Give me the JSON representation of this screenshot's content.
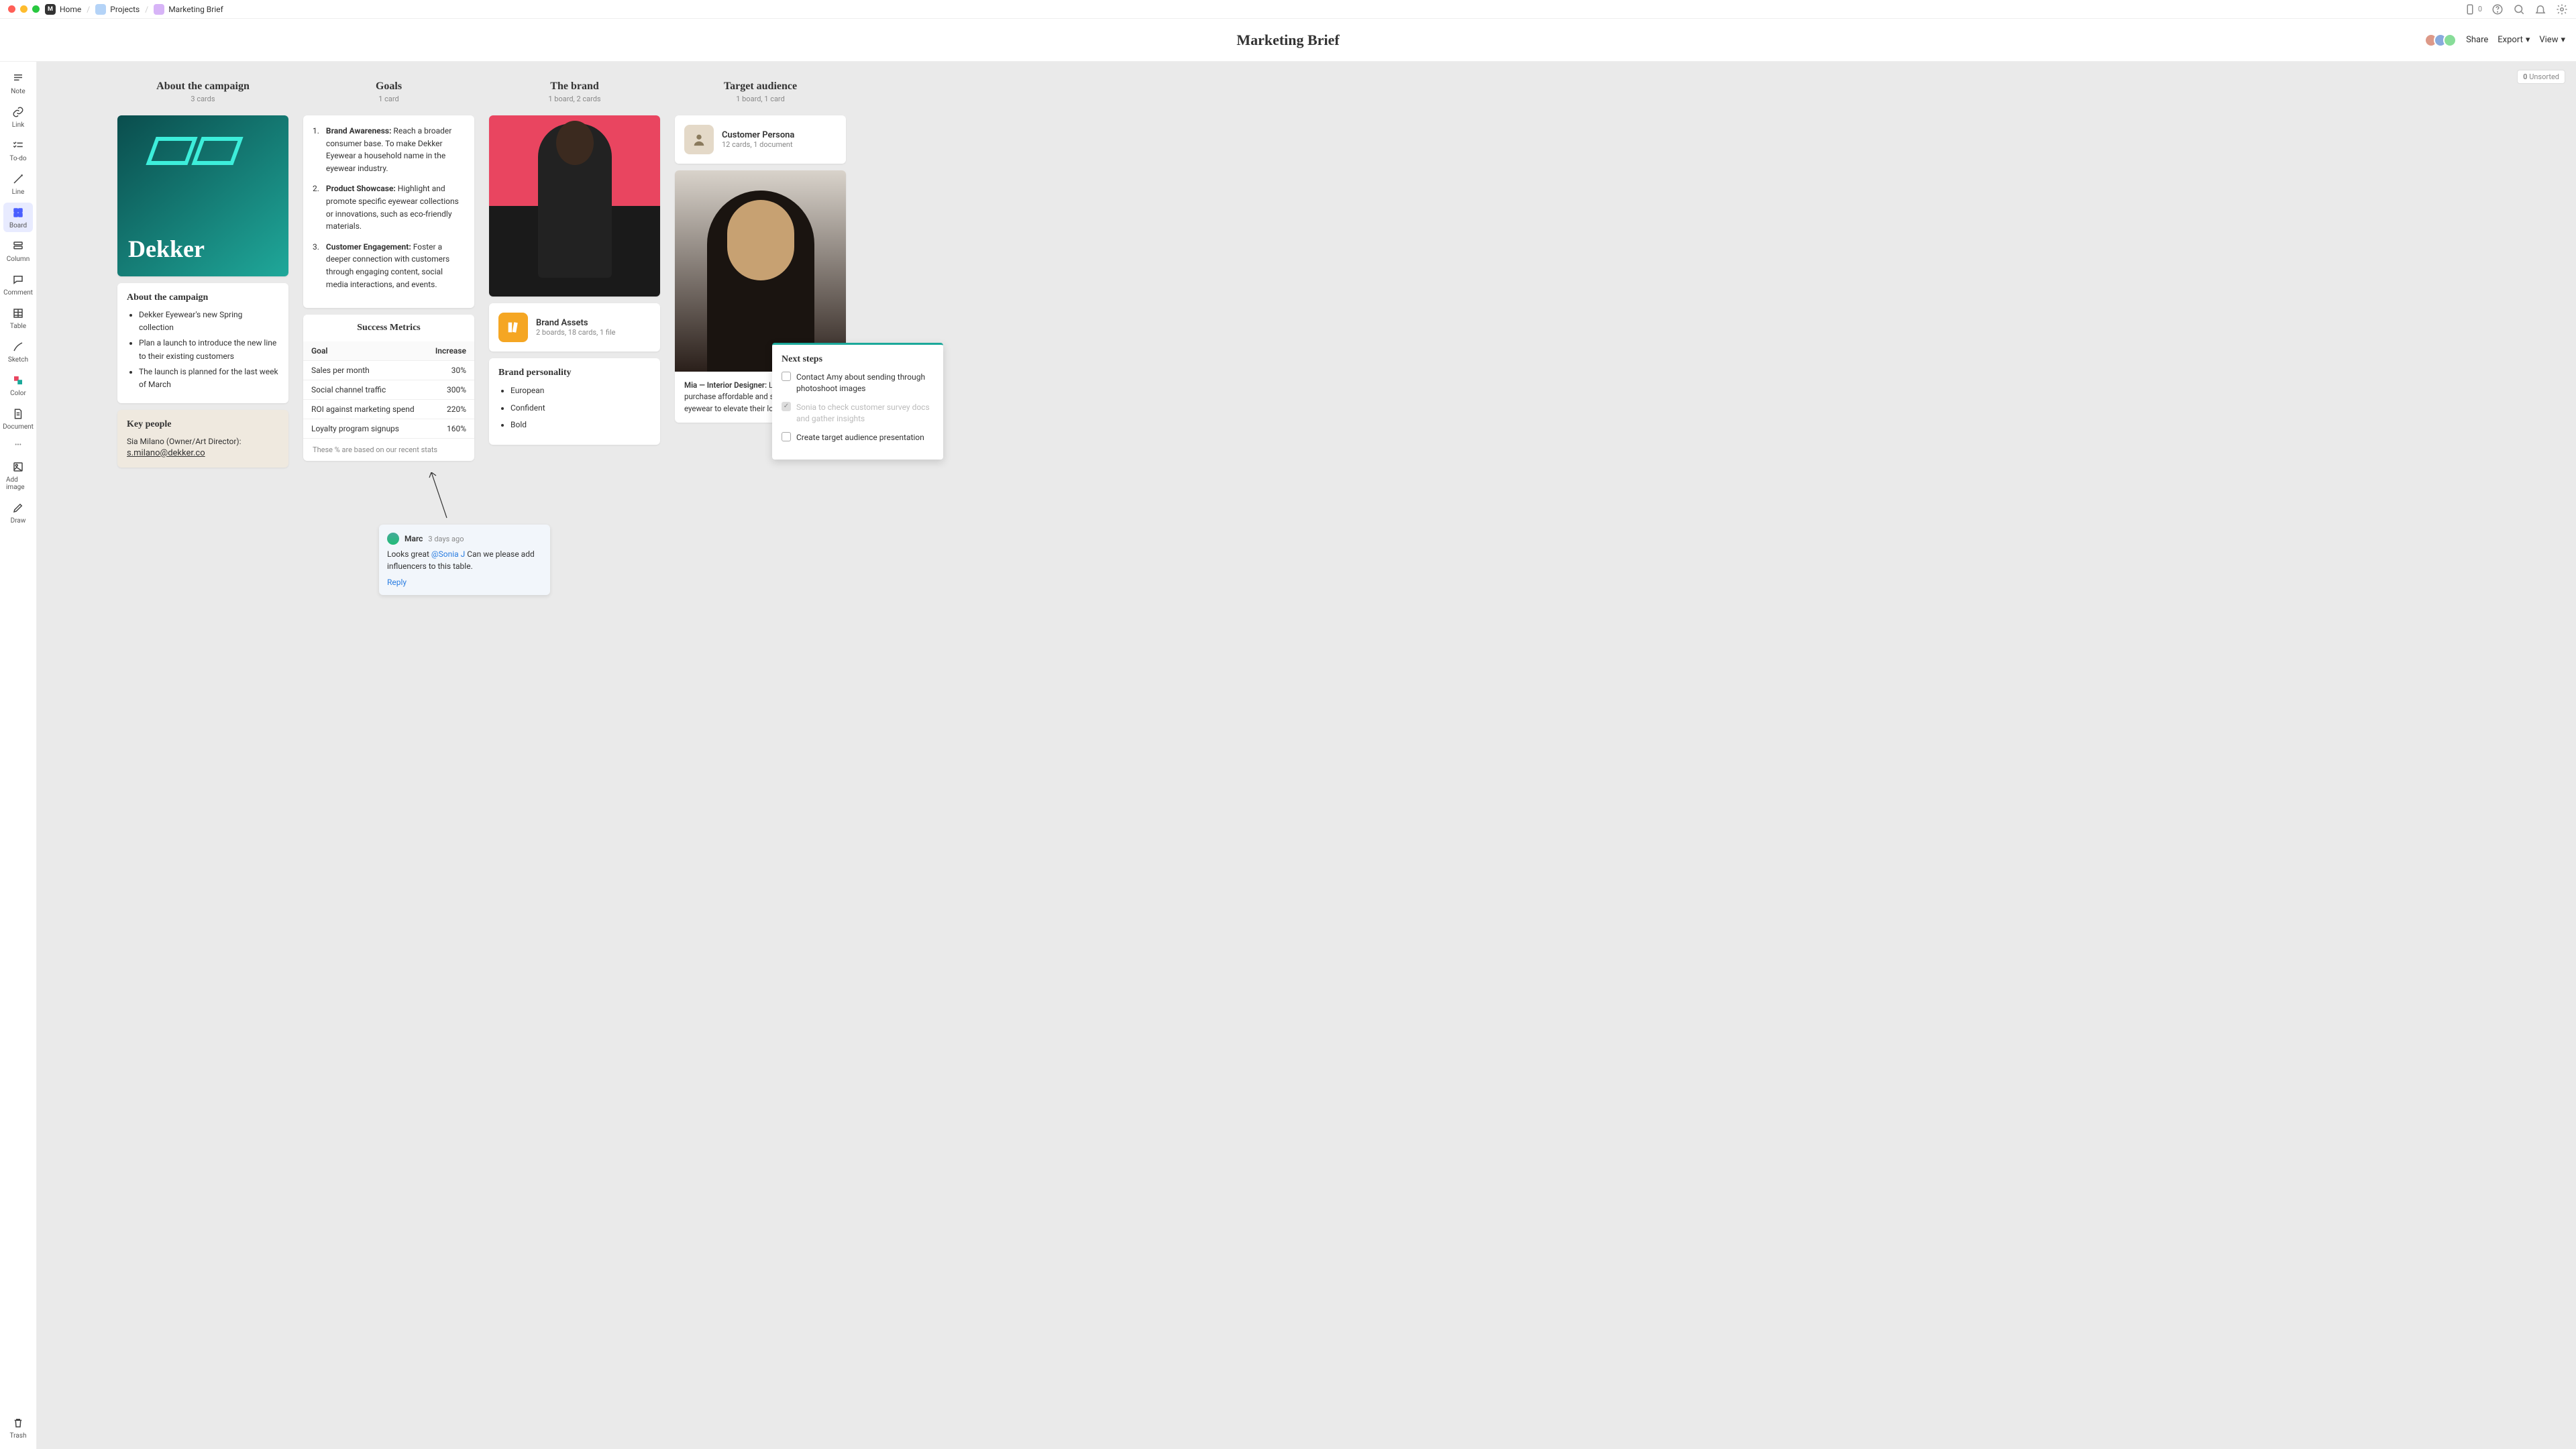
{
  "breadcrumbs": {
    "home": "Home",
    "projects": "Projects",
    "current": "Marketing Brief"
  },
  "header": {
    "title": "Marketing Brief",
    "share": "Share",
    "export": "Export",
    "view": "View",
    "device_count": "0",
    "unsorted": "0 Unsorted"
  },
  "sidebar": [
    {
      "id": "note",
      "label": "Note"
    },
    {
      "id": "link",
      "label": "Link"
    },
    {
      "id": "todo",
      "label": "To-do"
    },
    {
      "id": "line",
      "label": "Line"
    },
    {
      "id": "board",
      "label": "Board"
    },
    {
      "id": "column",
      "label": "Column"
    },
    {
      "id": "comment",
      "label": "Comment"
    },
    {
      "id": "table",
      "label": "Table"
    },
    {
      "id": "sketch",
      "label": "Sketch"
    },
    {
      "id": "color",
      "label": "Color"
    },
    {
      "id": "document",
      "label": "Document"
    },
    {
      "id": "addimage",
      "label": "Add image"
    },
    {
      "id": "draw",
      "label": "Draw"
    },
    {
      "id": "trash",
      "label": "Trash"
    }
  ],
  "columns": {
    "about": {
      "title": "About the campaign",
      "sub": "3 cards"
    },
    "goals": {
      "title": "Goals",
      "sub": "1 card"
    },
    "brand": {
      "title": "The brand",
      "sub": "1 board, 2 cards"
    },
    "audience": {
      "title": "Target audience",
      "sub": "1 board, 1 card"
    }
  },
  "about_card": {
    "brand_text": "Dekker",
    "heading": "About the campaign",
    "bullets": [
      "Dekker Eyewear's new Spring collection",
      "Plan a launch to introduce the new line to their existing customers",
      "The launch is planned for the last week of March"
    ]
  },
  "key_people": {
    "heading": "Key people",
    "line": "Sia Milano (Owner/Art Director):",
    "email": "s.milano@dekker.co"
  },
  "goals_list": [
    {
      "n": "1.",
      "title": "Brand Awareness:",
      "body": " Reach a broader consumer base. To make Dekker Eyewear a household name in the eyewear industry."
    },
    {
      "n": "2.",
      "title": "Product Showcase:",
      "body": " Highlight and promote specific eyewear collections or innovations, such as eco-friendly materials."
    },
    {
      "n": "3.",
      "title": "Customer Engagement:",
      "body": " Foster a deeper connection with customers through engaging content, social media interactions, and events."
    }
  ],
  "metrics": {
    "title": "Success Metrics",
    "headers": {
      "goal": "Goal",
      "increase": "Increase"
    },
    "rows": [
      {
        "goal": "Sales per month",
        "increase": "30%"
      },
      {
        "goal": "Social channel traffic",
        "increase": "300%"
      },
      {
        "goal": "ROI against marketing spend",
        "increase": "220%"
      },
      {
        "goal": "Loyalty program signups",
        "increase": "160%"
      }
    ],
    "note": "These % are based on our recent stats"
  },
  "brand_assets": {
    "name": "Brand Assets",
    "meta": "2 boards, 18 cards, 1 file"
  },
  "brand_personality": {
    "heading": "Brand personality",
    "items": [
      "European",
      "Confident",
      "Bold"
    ]
  },
  "persona_board": {
    "name": "Customer Persona",
    "meta": "12 cards, 1 document"
  },
  "audience_caption": {
    "bold": "Mia — Interior Designer:",
    "text": " Looking to purchase affordable and stylish statement eyewear to elevate their look."
  },
  "next_steps": {
    "title": "Next steps",
    "tasks": [
      {
        "done": false,
        "text": "Contact Amy about sending through photoshoot images"
      },
      {
        "done": true,
        "text": "Sonia to check customer survey docs and gather insights"
      },
      {
        "done": false,
        "text": "Create target audience presentation"
      }
    ]
  },
  "comment": {
    "name": "Marc",
    "time": "3 days ago",
    "text_before": "Looks great ",
    "mention": "@Sonia J",
    "text_after": " Can we please add influencers to this table.",
    "reply": "Reply"
  },
  "chart_data": {
    "type": "table",
    "title": "Success Metrics",
    "columns": [
      "Goal",
      "Increase"
    ],
    "rows": [
      [
        "Sales per month",
        "30%"
      ],
      [
        "Social channel traffic",
        "300%"
      ],
      [
        "ROI against marketing spend",
        "220%"
      ],
      [
        "Loyalty program signups",
        "160%"
      ]
    ],
    "note": "These % are based on our recent stats"
  }
}
